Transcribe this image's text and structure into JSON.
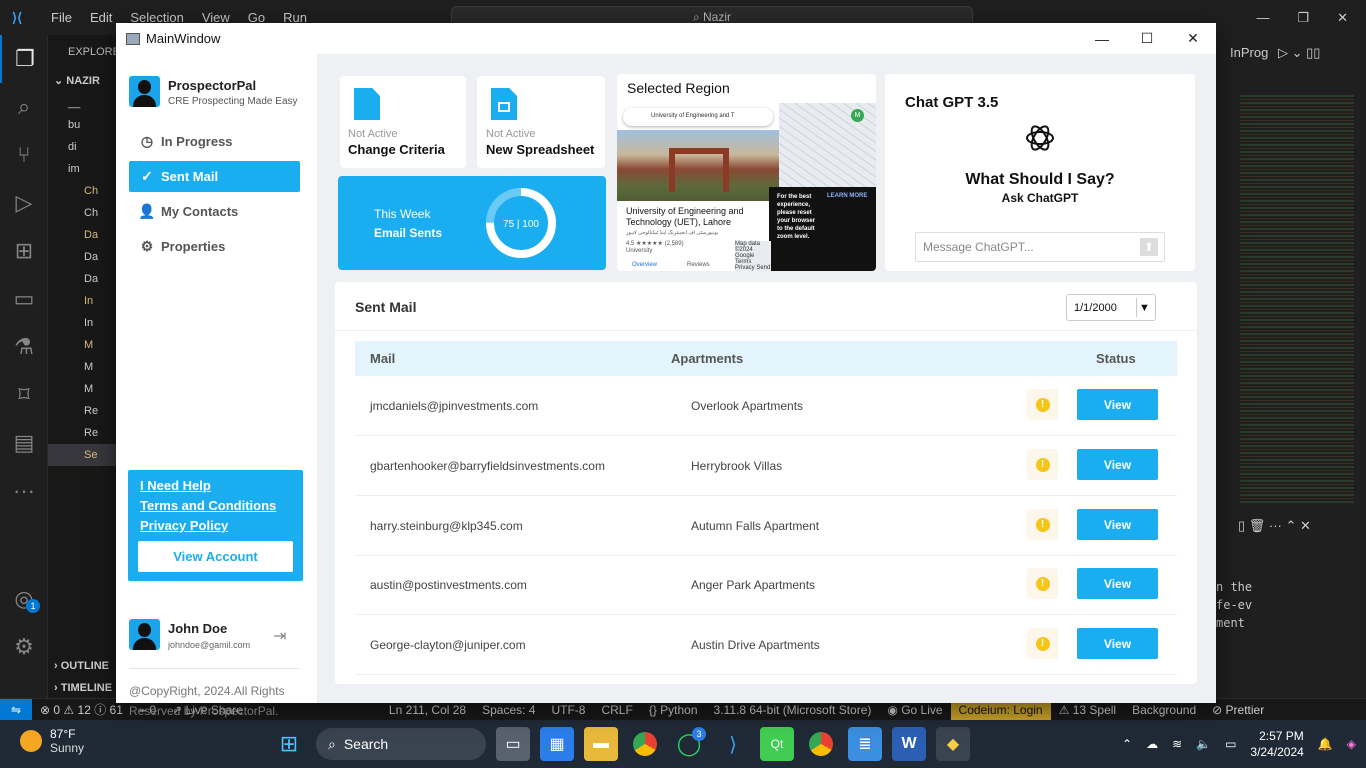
{
  "vscode": {
    "menu": [
      "File",
      "Edit",
      "Selection",
      "View",
      "Go",
      "Run"
    ],
    "command_center": "Nazir",
    "explorer_title": "EXPLORER",
    "folder": "NAZIR",
    "sidebar_rows": [
      "__",
      "bu",
      "di",
      "im",
      "Ch",
      "Ch",
      "Da",
      "Da",
      "Da",
      "In",
      "In",
      "M",
      "M",
      "M",
      "Re",
      "Re",
      "Se"
    ],
    "outline": "OUTLINE",
    "timeline": "TIMELINE",
    "editor_tab": "InProg",
    "terminal_lines": [
      "n the",
      "fe-ev",
      "",
      "ment"
    ],
    "accounts_badge": "1"
  },
  "statusbar": {
    "problems": "0",
    "warnings": "12",
    "infos": "61",
    "ports": "0",
    "live_share": "Live Share",
    "position": "Ln 211, Col 28",
    "spaces": "Spaces: 4",
    "encoding": "UTF-8",
    "eol": "CRLF",
    "language": "Python",
    "interpreter": "3.11.8 64-bit (Microsoft Store)",
    "go_live": "Go Live",
    "codeium": "Codeium: Login",
    "spell": "13 Spell",
    "background": "Background",
    "prettier": "Prettier"
  },
  "taskbar": {
    "temp": "87°F",
    "weather": "Sunny",
    "search": "Search",
    "whatsapp_badge": "3",
    "time": "2:57 PM",
    "date": "3/24/2024"
  },
  "window": {
    "title": "MainWindow"
  },
  "app": {
    "name": "ProspectorPal",
    "tagline": "CRE Prospecting Made Easy",
    "nav": [
      {
        "label": "In Progress"
      },
      {
        "label": "Sent Mail"
      },
      {
        "label": "My Contacts"
      },
      {
        "label": "Properties"
      }
    ],
    "help_links": [
      "I Need Help",
      "Terms and Conditions",
      "Privacy Policy"
    ],
    "view_account": "View Account",
    "user_name": "John Doe",
    "user_email": "johndoe@gamil.com",
    "copyright": "@CopyRight, 2024.All Rights Reserved by ProspectorPal."
  },
  "cards": {
    "criteria_status": "Not Active",
    "criteria_title": "Change Criteria",
    "spreadsheet_status": "Not Active",
    "spreadsheet_title": "New Spreadsheet",
    "week_label": "This Week",
    "week_sub": "Email Sents",
    "week_progress_text": "75 | 100",
    "week_progress_value": 75,
    "week_progress_max": 100,
    "region_title": "Selected Region",
    "map_search": "University of Engineering and T",
    "map_place": "University of Engineering and Technology (UET), Lahore",
    "map_urdu": "یونیورسٹی آف انجینئرنگ اینڈ ٹیکنالوجی لاہور",
    "map_rating": "4.5 ★★★★★ (2,589)",
    "map_type": "University",
    "map_tab1": "Overview",
    "map_tab2": "Reviews",
    "map_popup": "For the best experience, please reset your browser to the default zoom level.",
    "map_learn": "LEARN MORE",
    "map_footer": "Map data ©2024 Google Terms Privacy Send Product",
    "chat_title": "Chat GPT 3.5",
    "chat_q1": "What Should I Say?",
    "chat_q2": "Ask ChatGPT",
    "chat_placeholder": "Message ChatGPT..."
  },
  "sent_mail": {
    "title": "Sent Mail",
    "date": "1/1/2000",
    "headers": {
      "mail": "Mail",
      "apartments": "Apartments",
      "status": "Status"
    },
    "view_label": "View",
    "rows": [
      {
        "mail": "jmcdaniels@jpinvestments.com",
        "apt": "Overlook Apartments"
      },
      {
        "mail": "gbartenhooker@barryfieldsinvestments.com",
        "apt": "Herrybrook Villas"
      },
      {
        "mail": "harry.steinburg@klp345.com",
        "apt": "Autumn Falls Apartment"
      },
      {
        "mail": "austin@postinvestments.com",
        "apt": "Anger Park Apartments"
      },
      {
        "mail": "George-clayton@juniper.com",
        "apt": "Austin Drive Apartments"
      }
    ]
  },
  "colors": {
    "accent": "#1aaef0",
    "warning": "#f5c518"
  }
}
